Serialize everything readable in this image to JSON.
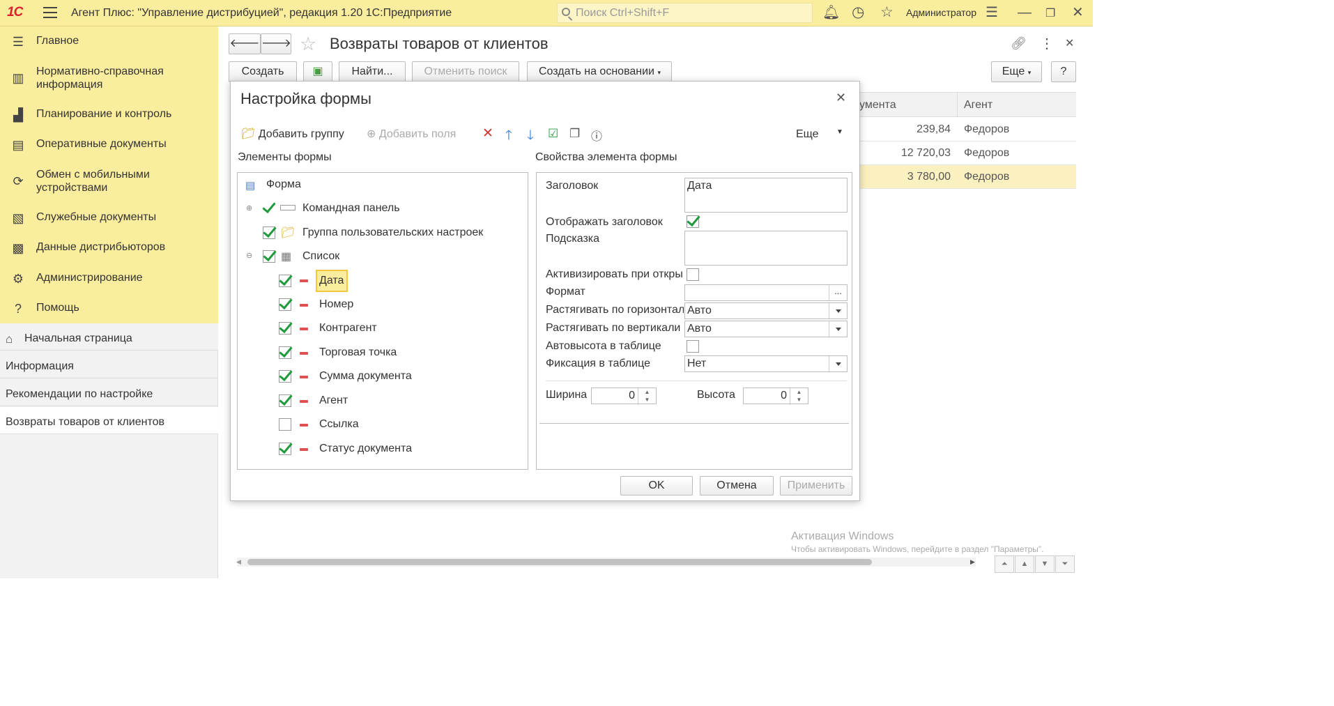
{
  "app": {
    "logo": "1С",
    "title": "Агент Плюс: \"Управление дистрибуцией\", редакция 1.20 1С:Предприятие",
    "search_placeholder": "Поиск Ctrl+Shift+F",
    "user": "Администратор"
  },
  "sidebar": {
    "sections": [
      {
        "label": "Главное",
        "icon": "menu-lines-icon"
      },
      {
        "label": "Нормативно-справочная информация",
        "line1": "Нормативно-справочная",
        "line2": "информация",
        "icon": "catalog-icon"
      },
      {
        "label": "Планирование и контроль",
        "icon": "chart-icon"
      },
      {
        "label": "Оперативные документы",
        "icon": "documents-icon"
      },
      {
        "label": "Обмен с мобильными устройствами",
        "line1": "Обмен с мобильными",
        "line2": "устройствами",
        "icon": "sync-icon"
      },
      {
        "label": "Служебные документы",
        "icon": "service-docs-icon"
      },
      {
        "label": "Данные дистрибьюторов",
        "icon": "distributor-icon"
      },
      {
        "label": "Администрирование",
        "icon": "gear-icon"
      },
      {
        "label": "Помощь",
        "icon": "help-icon"
      }
    ],
    "nav": [
      {
        "label": "Начальная страница",
        "icon": "home-icon"
      },
      {
        "label": "Информация"
      },
      {
        "label": "Рекомендации по настройке"
      },
      {
        "label": "Возвраты товаров от клиентов",
        "active": true
      }
    ]
  },
  "page": {
    "title": "Возвраты товаров от клиентов",
    "buttons": {
      "create": "Создать",
      "find": "Найти...",
      "cancel_search": "Отменить поиск",
      "create_based": "Создать на основании",
      "more": "Еще",
      "help": "?"
    },
    "grid": {
      "columns": [
        "умента",
        "Агент"
      ],
      "rows": [
        {
          "sum": "239,84",
          "agent": "Федоров"
        },
        {
          "sum": "12 720,03",
          "agent": "Федоров"
        },
        {
          "sum": "3 780,00",
          "agent": "Федоров",
          "selected": true
        }
      ]
    }
  },
  "dialog": {
    "title": "Настройка формы",
    "toolbar": {
      "add_group": "Добавить группу",
      "add_fields": "Добавить поля",
      "more": "Еще"
    },
    "left_header": "Элементы формы",
    "right_header": "Свойства элемента формы",
    "tree": {
      "root": "Форма",
      "items": [
        {
          "label": "Командная панель",
          "checked": true,
          "level": 1
        },
        {
          "label": "Группа пользовательских настроек",
          "checked": true,
          "level": 1
        },
        {
          "label": "Список",
          "checked": true,
          "level": 1
        }
      ],
      "children": [
        {
          "label": "Дата",
          "checked": true,
          "selected": true
        },
        {
          "label": "Номер",
          "checked": true
        },
        {
          "label": "Контрагент",
          "checked": true
        },
        {
          "label": "Торговая точка",
          "checked": true
        },
        {
          "label": "Сумма документа",
          "checked": true
        },
        {
          "label": "Агент",
          "checked": true
        },
        {
          "label": "Ссылка",
          "checked": false
        },
        {
          "label": "Статус документа",
          "checked": true
        }
      ]
    },
    "props": {
      "title_label": "Заголовок",
      "title_value": "Дата",
      "show_title_label": "Отображать заголовок",
      "show_title": true,
      "hint_label": "Подсказка",
      "activate_label": "Активизировать при откры",
      "activate": false,
      "format_label": "Формат",
      "stretch_h_label": "Растягивать по горизонтал",
      "stretch_h_value": "Авто",
      "stretch_v_label": "Растягивать по вертикали",
      "stretch_v_value": "Авто",
      "autoheight_label": "Автовысота в таблице",
      "autoheight": false,
      "fix_label": "Фиксация в таблице",
      "fix_value": "Нет",
      "width_label": "Ширина",
      "width_value": "0",
      "height_label": "Высота",
      "height_value": "0"
    },
    "buttons": {
      "ok": "OK",
      "cancel": "Отмена",
      "apply": "Применить"
    }
  },
  "watermark": {
    "line1": "Активация Windows",
    "line2": "Чтобы активировать Windows, перейдите в раздел \"Параметры\"."
  }
}
